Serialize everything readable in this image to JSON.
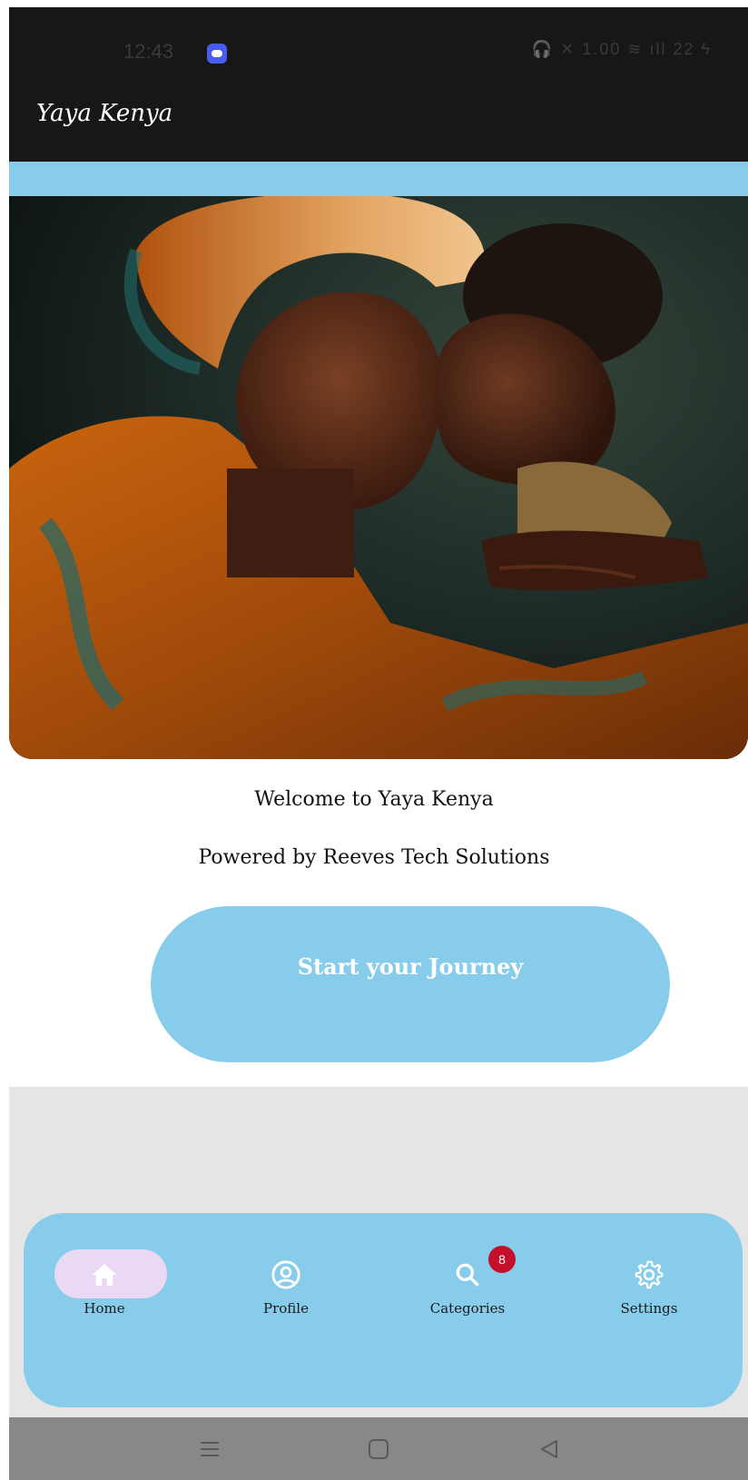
{
  "status_bar": {
    "time": "12:43",
    "icons_text": "🎧 ✕ 1.00 ≋ ıll 22 ϟ"
  },
  "app_bar": {
    "title": "Yaya Kenya"
  },
  "hero": {
    "image_desc": "mother-and-child-painting"
  },
  "content": {
    "welcome": "Welcome to Yaya Kenya",
    "powered_by": "Powered by Reeves Tech Solutions",
    "start_button": "Start your Journey"
  },
  "bottom_nav": {
    "items": [
      {
        "label": "Home",
        "icon": "home-icon",
        "selected": true
      },
      {
        "label": "Profile",
        "icon": "profile-icon",
        "selected": false
      },
      {
        "label": "Categories",
        "icon": "search-icon",
        "selected": false,
        "badge": "8"
      },
      {
        "label": "Settings",
        "icon": "gear-icon",
        "selected": false
      }
    ]
  },
  "colors": {
    "accent": "#87ccea",
    "app_bar": "#171717",
    "nav_pill": "#ead9f4",
    "badge": "#c4102a"
  }
}
